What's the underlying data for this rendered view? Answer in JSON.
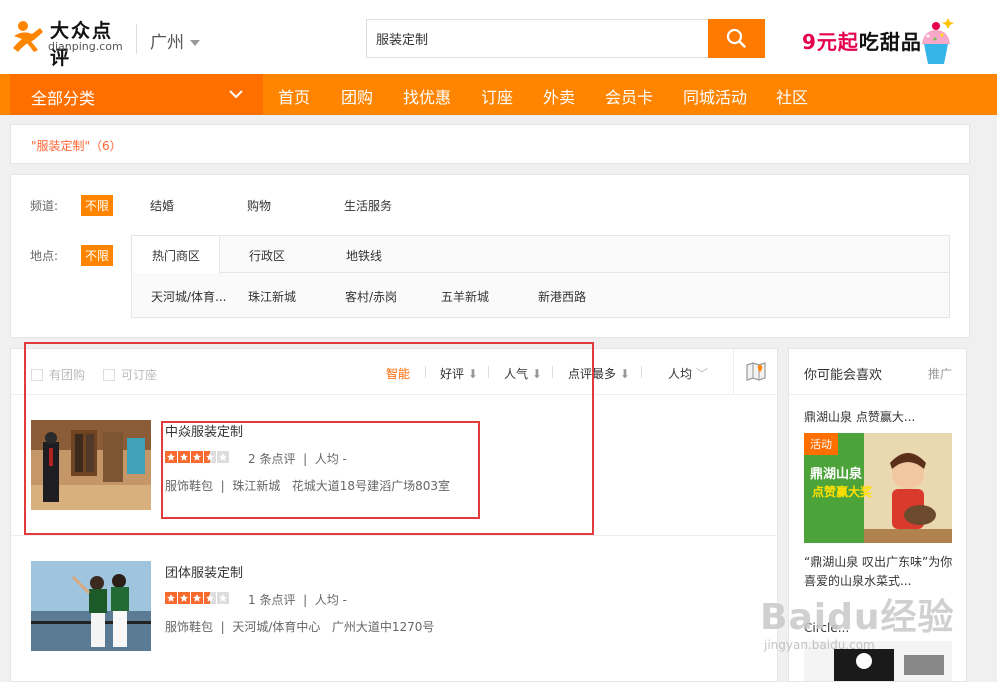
{
  "header": {
    "logo_cn": "大众点评",
    "logo_en": "dianping.com",
    "city": "广州",
    "search_value": "服装定制",
    "promo_prefix": "9元起",
    "promo_suffix": "吃甜品"
  },
  "nav": {
    "all_label": "全部分类",
    "items": [
      "首页",
      "团购",
      "找优惠",
      "订座",
      "外卖",
      "会员卡",
      "同城活动",
      "社区"
    ]
  },
  "breadcrumb": "\"服装定制\"（6）",
  "filters": {
    "channel_label": "频道:",
    "channel_selected": "不限",
    "channel_options": [
      "结婚",
      "购物",
      "生活服务"
    ],
    "area_label": "地点:",
    "area_selected": "不限",
    "area_tabs": [
      "热门商区",
      "行政区",
      "地铁线"
    ],
    "area_options": [
      "天河城/体育...",
      "珠江新城",
      "客村/赤岗",
      "五羊新城",
      "新港西路"
    ]
  },
  "toolbar": {
    "checks": [
      "有团购",
      "可订座"
    ],
    "sorts": [
      "智能",
      "好评",
      "人气",
      "点评最多",
      "人均"
    ]
  },
  "shops": [
    {
      "name": "中焱服装定制",
      "rating": 3.5,
      "reviews": "2 条点评",
      "avg": "人均 -",
      "category": "服饰鞋包",
      "district": "珠江新城",
      "address": "花城大道18号建滔广场803室"
    },
    {
      "name": "团体服装定制",
      "rating": 3.5,
      "reviews": "1 条点评",
      "avg": "人均 -",
      "category": "服饰鞋包",
      "district": "天河城/体育中心",
      "address": "广州大道中1270号"
    }
  ],
  "sidebar": {
    "title": "你可能会喜欢",
    "more": "推广",
    "item_title": "鼎湖山泉 点赞赢大...",
    "ad_badge": "活动",
    "ad_line1": "鼎湖山泉",
    "ad_line2": "点赞赢大奖",
    "desc": "“鼎湖山泉 叹出广东味”为你喜爱的山泉水菜式...",
    "item2": "Circle..."
  },
  "watermark": {
    "text": "Baidu经验",
    "sub": "jingyan.baidu.com"
  },
  "colors": {
    "brand_orange": "#ff8400",
    "nav_dark": "#ff6f00",
    "highlight_red": "#e03c3c",
    "star": "#f76b2f"
  }
}
